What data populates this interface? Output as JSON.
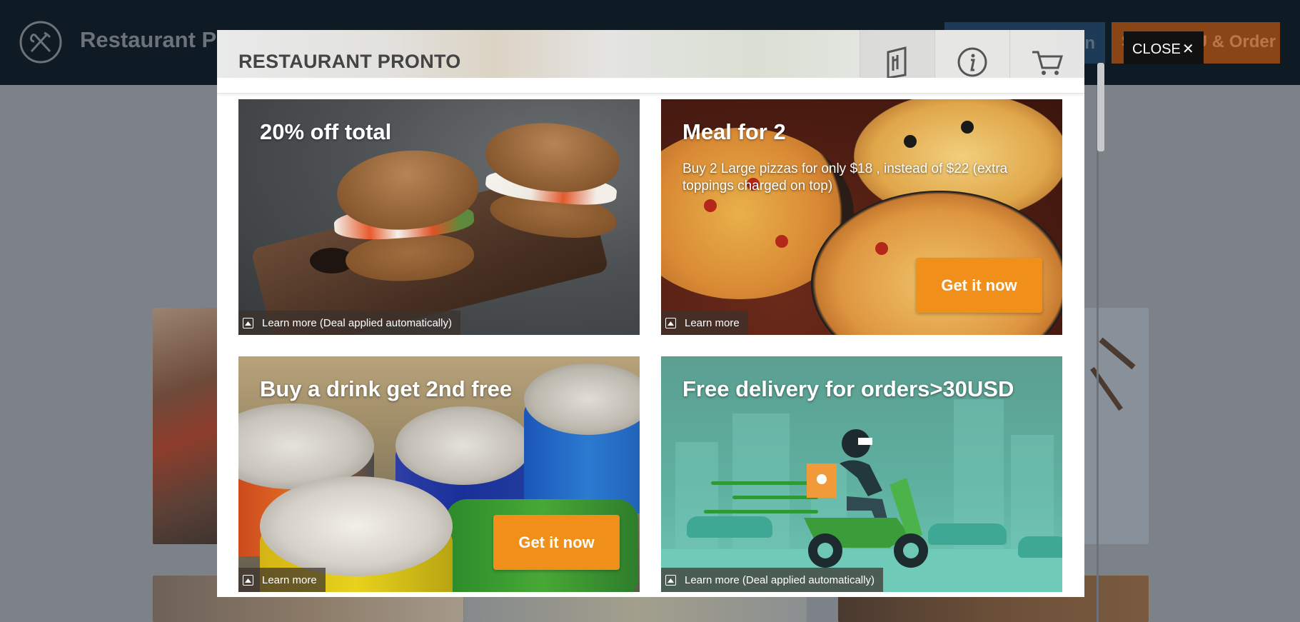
{
  "background_page": {
    "restaurant_name": "Restaurant Pronto",
    "button_a_label": "n",
    "button_b_label": "See MENU & Order"
  },
  "modal": {
    "title": "RESTAURANT PRONTO",
    "header_icons": [
      "menu-icon",
      "info-icon",
      "cart-icon"
    ],
    "close_label": "CLOSE",
    "close_glyph": "✕"
  },
  "deals": [
    {
      "title": "20% off total",
      "description": "",
      "cta_label": "",
      "learn_more_label": "Learn more (Deal applied automatically)"
    },
    {
      "title": "Meal for 2",
      "description": "Buy 2 Large pizzas for only $18 , instead of $22 (extra toppings charged on top)",
      "cta_label": "Get it now",
      "learn_more_label": "Learn more"
    },
    {
      "title": "Buy a drink get 2nd free",
      "description": "",
      "cta_label": "Get it now",
      "learn_more_label": "Learn more"
    },
    {
      "title": "Free delivery for orders>30USD",
      "description": "",
      "cta_label": "",
      "learn_more_label": "Learn more (Deal applied automatically)"
    }
  ],
  "colors": {
    "accent_orange": "#f0901a",
    "header_dark": "#0e1a24",
    "close_button": "#111111"
  }
}
